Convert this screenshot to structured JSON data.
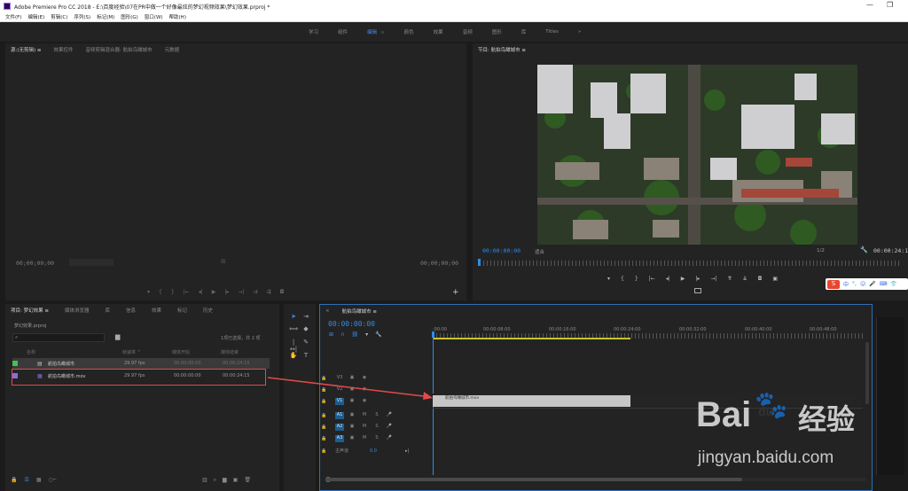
{
  "titlebar": {
    "title": "Adobe Premiere Pro CC 2018 - E:\\百度经验\\07在PR中做一个好像最炫的梦幻视频效果\\梦幻效果.prproj *",
    "minimize": "—",
    "restore": "❐"
  },
  "menu": [
    "文件(F)",
    "编辑(E)",
    "剪辑(C)",
    "序列(S)",
    "标记(M)",
    "图形(G)",
    "窗口(W)",
    "帮助(H)"
  ],
  "workspaces": [
    {
      "label": "学习",
      "active": false
    },
    {
      "label": "组件",
      "active": false
    },
    {
      "label": "编辑",
      "active": true
    },
    {
      "label": "颜色",
      "active": false
    },
    {
      "label": "效果",
      "active": false
    },
    {
      "label": "音频",
      "active": false
    },
    {
      "label": "图形",
      "active": false
    },
    {
      "label": "库",
      "active": false
    },
    {
      "label": "Titles",
      "active": false
    },
    {
      "label": "»",
      "active": false
    }
  ],
  "source": {
    "tabs": [
      "源:(无剪辑)  ≡",
      "效果控件",
      "音频剪辑混合器: 航拍鸟瞰城市",
      "元数据"
    ],
    "tc_left": "00;00;00;00",
    "tc_right": "00;00;00;00"
  },
  "program": {
    "tab": "节目: 航拍鸟瞰城市  ≡",
    "timecode": "00:00:00:00",
    "fit": "适合",
    "quality": "1/2",
    "duration": "00:00:24:1"
  },
  "project": {
    "tabs": [
      "项目: 梦幻效果  ≡",
      "媒体浏览器",
      "库",
      "信息",
      "效果",
      "标记",
      "历史"
    ],
    "file": "梦幻效果.prproj",
    "selection": "1项已选择，共 2 项",
    "columns": {
      "name": "名称",
      "fps": "帧速率 ^",
      "start": "媒体开始",
      "end": "媒体结束"
    },
    "items": [
      {
        "name": "航拍鸟瞰城市",
        "fps": "29.97 fps",
        "start": "00:00:00:00",
        "end": "00:00:24:15",
        "color": "#3fc44d"
      },
      {
        "name": "航拍鸟瞰城市.mov",
        "fps": "29.97 fps",
        "start": "00:00:00:00",
        "end": "00:00:24:15",
        "color": "#8a6ce0"
      }
    ]
  },
  "timeline": {
    "tab": "航拍鸟瞰城市  ≡",
    "timecode": "00:00:00:00",
    "ruler": [
      ":00:00",
      "00:00:08:00",
      "00:00:16:00",
      "00:00:24:00",
      "00:00:32:00",
      "00:00:40:00",
      "00:00:48:00"
    ],
    "tracks": [
      {
        "label": "V3",
        "active": false,
        "kind": "video"
      },
      {
        "label": "V2",
        "active": false,
        "kind": "video"
      },
      {
        "label": "V1",
        "active": true,
        "kind": "video"
      },
      {
        "label": "A1",
        "active": true,
        "kind": "audio"
      },
      {
        "label": "A2",
        "active": true,
        "kind": "audio"
      },
      {
        "label": "A3",
        "active": true,
        "kind": "audio"
      }
    ],
    "master": "主声道",
    "master_value": "0.0",
    "clip_label": "航拍鸟瞰城市.mov",
    "clip_fraction": 0.5
  },
  "watermark": {
    "brand": "Bai",
    "paw": "du",
    "cn": "经验",
    "url": "jingyan.baidu.com"
  },
  "colors": {
    "accent_blue": "#2d8ceb",
    "highlight_red": "#e24a4a",
    "clip_gray": "#c6c6c6",
    "workarea_yellow": "#c9c22b"
  }
}
